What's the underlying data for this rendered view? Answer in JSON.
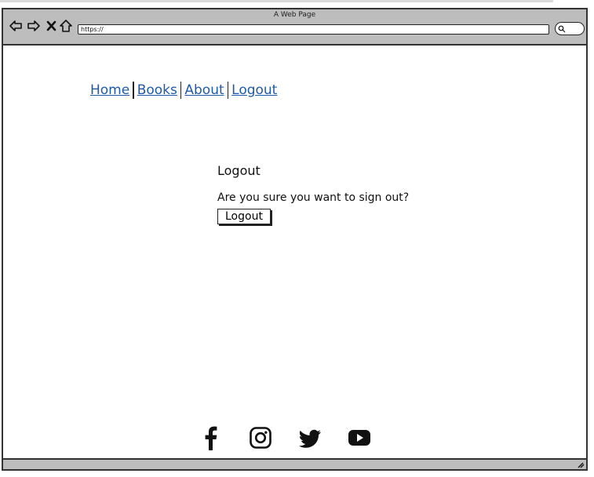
{
  "browser": {
    "title": "A Web Page",
    "url": "https://"
  },
  "nav": {
    "items": [
      {
        "label": "Home"
      },
      {
        "label": "Books"
      },
      {
        "label": "About"
      },
      {
        "label": "Logout"
      }
    ]
  },
  "logout": {
    "heading": "Logout",
    "message": "Are you sure you want to sign out?",
    "button_label": "Logout"
  },
  "social": {
    "icons": [
      "facebook-icon",
      "instagram-icon",
      "twitter-icon",
      "youtube-icon"
    ]
  },
  "colors": {
    "link": "#1f5aa8",
    "chrome": "#bdbdbd"
  }
}
